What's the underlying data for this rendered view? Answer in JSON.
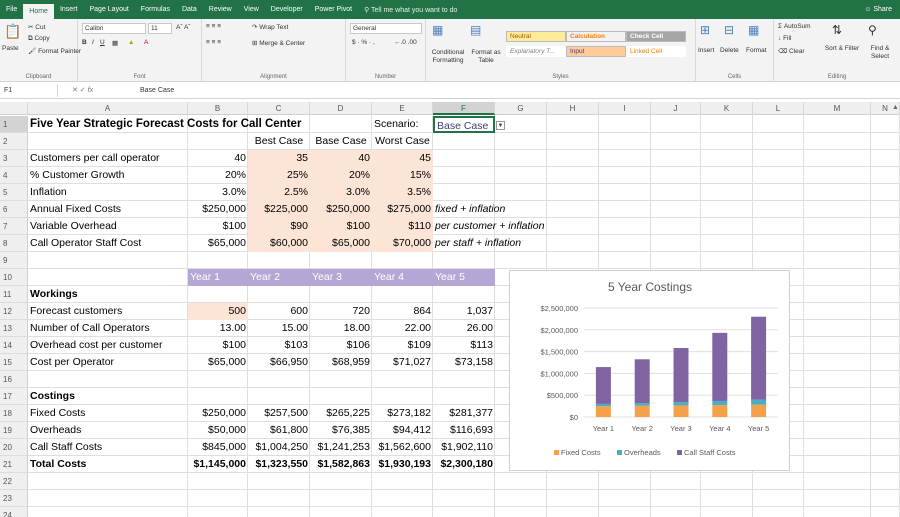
{
  "menu": {
    "tabs": [
      "File",
      "Home",
      "Insert",
      "Page Layout",
      "Formulas",
      "Data",
      "Review",
      "View",
      "Developer",
      "Power Pivot"
    ],
    "active": "Home",
    "tell_me": "Tell me what you want to do",
    "share": "Share"
  },
  "ribbon": {
    "clipboard": {
      "label": "Clipboard",
      "paste": "Paste",
      "cut": "Cut",
      "copy": "Copy",
      "format_painter": "Format Painter"
    },
    "font": {
      "label": "Font",
      "name": "Calibri",
      "size": "11"
    },
    "alignment": {
      "label": "Alignment",
      "wrap": "Wrap Text",
      "merge": "Merge & Center"
    },
    "number": {
      "label": "Number",
      "format": "General"
    },
    "styles": {
      "label": "Styles",
      "cond": "Conditional Formatting",
      "format_table": "Format as Table",
      "neutral": "Neutral",
      "calculation": "Calculation",
      "check_cell": "Check Cell",
      "explanatory": "Explanatory T...",
      "input": "Input",
      "linked_cell": "Linked Cell"
    },
    "cells": {
      "label": "Cells",
      "insert": "Insert",
      "delete": "Delete",
      "format": "Format"
    },
    "editing": {
      "label": "Editing",
      "autosum": "AutoSum",
      "fill": "Fill",
      "clear": "Clear",
      "sort": "Sort & Filter",
      "find": "Find & Select"
    }
  },
  "formula_bar": {
    "name_box": "F1",
    "fx": "fx",
    "value": "Base Case"
  },
  "columns": [
    "A",
    "B",
    "C",
    "D",
    "E",
    "F",
    "G",
    "H",
    "I",
    "J",
    "K",
    "L",
    "M",
    "N"
  ],
  "rows": [
    "1",
    "2",
    "3",
    "4",
    "5",
    "6",
    "7",
    "8",
    "9",
    "10",
    "11",
    "12",
    "13",
    "14",
    "15",
    "16",
    "17",
    "18",
    "19",
    "20",
    "21",
    "22",
    "23",
    "24"
  ],
  "sheet": {
    "title": "Five Year Strategic Forecast Costs for Call Center",
    "scenario_label": "Scenario:",
    "scenario_value": "Base Case",
    "cases": [
      "Best Case",
      "Base Case",
      "Worst Case"
    ],
    "inputs": [
      {
        "label": "Customers per call operator",
        "current": "40",
        "best": "35",
        "base": "40",
        "worst": "45",
        "note": ""
      },
      {
        "label": "% Customer Growth",
        "current": "20%",
        "best": "25%",
        "base": "20%",
        "worst": "15%",
        "note": ""
      },
      {
        "label": "Inflation",
        "current": "3.0%",
        "best": "2.5%",
        "base": "3.0%",
        "worst": "3.5%",
        "note": ""
      },
      {
        "label": "Annual Fixed Costs",
        "current": "$250,000",
        "best": "$225,000",
        "base": "$250,000",
        "worst": "$275,000",
        "note": "fixed + inflation"
      },
      {
        "label": "Variable Overhead",
        "current": "$100",
        "best": "$90",
        "base": "$100",
        "worst": "$110",
        "note": "per customer + inflation"
      },
      {
        "label": "Call Operator Staff Cost",
        "current": "$65,000",
        "best": "$60,000",
        "base": "$65,000",
        "worst": "$70,000",
        "note": "per staff + inflation"
      }
    ],
    "years": [
      "Year 1",
      "Year 2",
      "Year 3",
      "Year 4",
      "Year 5"
    ],
    "workings_label": "Workings",
    "workings": [
      {
        "label": "Forecast customers",
        "values": [
          "500",
          "600",
          "720",
          "864",
          "1,037"
        ]
      },
      {
        "label": "Number of Call Operators",
        "values": [
          "13.00",
          "15.00",
          "18.00",
          "22.00",
          "26.00"
        ]
      },
      {
        "label": "Overhead cost per customer",
        "values": [
          "$100",
          "$103",
          "$106",
          "$109",
          "$113"
        ]
      },
      {
        "label": "Cost per Operator",
        "values": [
          "$65,000",
          "$66,950",
          "$68,959",
          "$71,027",
          "$73,158"
        ]
      }
    ],
    "costings_label": "Costings",
    "costings": [
      {
        "label": "Fixed Costs",
        "values": [
          "$250,000",
          "$257,500",
          "$265,225",
          "$273,182",
          "$281,377"
        ]
      },
      {
        "label": "Overheads",
        "values": [
          "$50,000",
          "$61,800",
          "$76,385",
          "$94,412",
          "$116,693"
        ]
      },
      {
        "label": "Call Staff Costs",
        "values": [
          "$845,000",
          "$1,004,250",
          "$1,241,253",
          "$1,562,600",
          "$1,902,110"
        ]
      },
      {
        "label": "Total Costs",
        "values": [
          "$1,145,000",
          "$1,323,550",
          "$1,582,863",
          "$1,930,193",
          "$2,300,180"
        ]
      }
    ]
  },
  "chart_data": {
    "type": "bar",
    "stacked": true,
    "title": "5 Year Costings",
    "categories": [
      "Year 1",
      "Year 2",
      "Year 3",
      "Year 4",
      "Year 5"
    ],
    "series": [
      {
        "name": "Fixed Costs",
        "color": "#f4a14a",
        "values": [
          250000,
          257500,
          265225,
          273182,
          281377
        ]
      },
      {
        "name": "Overheads",
        "color": "#4bacc6",
        "values": [
          50000,
          61800,
          76385,
          94412,
          116693
        ]
      },
      {
        "name": "Call Staff Costs",
        "color": "#8064a2",
        "values": [
          845000,
          1004250,
          1241253,
          1562600,
          1902110
        ]
      }
    ],
    "ylim": [
      0,
      2500000
    ],
    "yticks": [
      "$2,500,000",
      "$2,000,000",
      "$1,500,000",
      "$1,000,000",
      "$500,000",
      "$0"
    ],
    "grid": true,
    "legend": "bottom"
  }
}
